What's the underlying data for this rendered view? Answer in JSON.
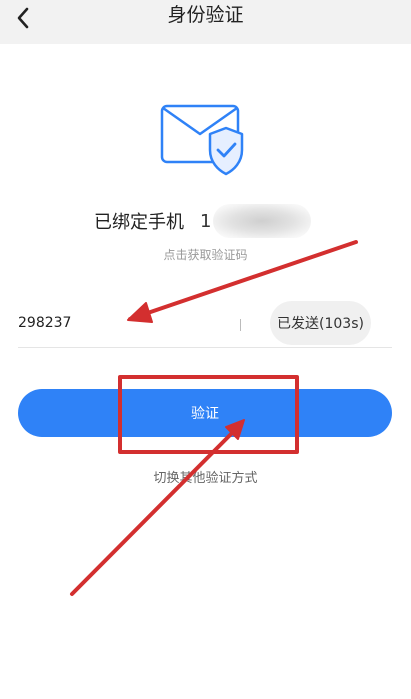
{
  "header": {
    "title": "身份验证",
    "back_icon": "chevron-left-icon"
  },
  "illustration": {
    "icon": "envelope-shield-check-icon"
  },
  "binding": {
    "label": "已绑定手机",
    "phone_prefix": "1"
  },
  "get_code_hint": "点击获取验证码",
  "code_input": {
    "value": "298237"
  },
  "resend_button": {
    "label": "已发送(103s)"
  },
  "verify_button": {
    "label": "验证"
  },
  "switch_method_link": "切换其他验证方式",
  "colors": {
    "accent": "#2f82f7",
    "annotation": "#d32f2f",
    "nav_bg": "#f2f2f2"
  }
}
